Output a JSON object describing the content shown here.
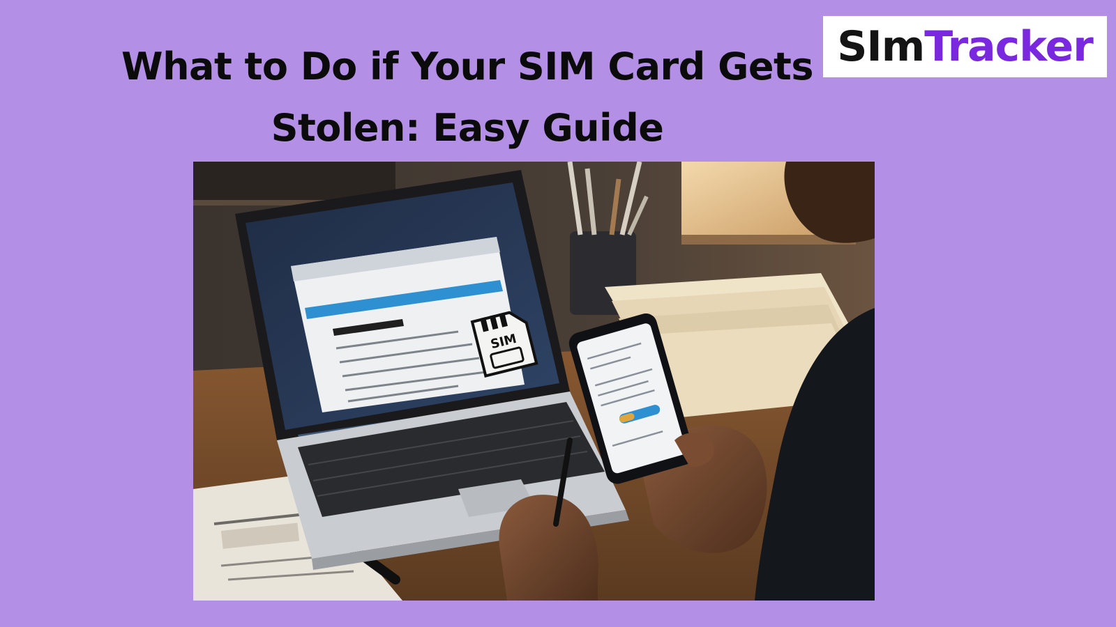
{
  "title": {
    "line1": "What to Do if Your SIM Card Gets",
    "line2": "Stolen: Easy Guide"
  },
  "logo": {
    "part1": "SIm",
    "part2": "Tracker",
    "colors": {
      "part1": "#141414",
      "part2": "#7a27e0"
    }
  },
  "illustration": {
    "sim_label": "SIM"
  },
  "colors": {
    "background": "#b38fe6",
    "title": "#0b0b0b"
  }
}
